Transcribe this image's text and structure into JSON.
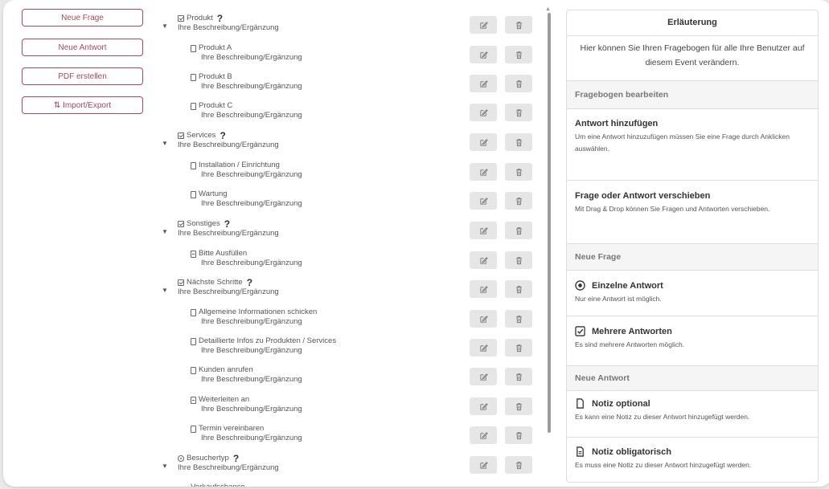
{
  "left_buttons": {
    "new_question": "Neue Frage",
    "new_answer": "Neue Antwort",
    "create_pdf": "PDF erstellen",
    "import_export": "Import/Export"
  },
  "tree": [
    {
      "kind": "question",
      "icon": "checkbox-icon",
      "title": "Produkt",
      "desc": "Ihre Beschreibung/Ergänzung"
    },
    {
      "kind": "answer",
      "icon": "document-icon",
      "title": "Produkt A",
      "desc": "Ihre Beschreibung/Ergänzung"
    },
    {
      "kind": "answer",
      "icon": "document-icon",
      "title": "Produkt B",
      "desc": "Ihre Beschreibung/Ergänzung"
    },
    {
      "kind": "answer",
      "icon": "document-icon",
      "title": "Produkt C",
      "desc": "Ihre Beschreibung/Ergänzung"
    },
    {
      "kind": "question",
      "icon": "checkbox-icon",
      "title": "Services",
      "desc": "Ihre Beschreibung/Ergänzung"
    },
    {
      "kind": "answer",
      "icon": "document-icon",
      "title": "Installation / Einrichtung",
      "desc": "Ihre Beschreibung/Ergänzung"
    },
    {
      "kind": "answer",
      "icon": "document-icon",
      "title": "Wartung",
      "desc": "Ihre Beschreibung/Ergänzung"
    },
    {
      "kind": "question",
      "icon": "checkbox-icon",
      "title": "Sonstiges",
      "desc": "Ihre Beschreibung/Ergänzung"
    },
    {
      "kind": "answer",
      "icon": "document-lines-icon",
      "title": "Bitte Ausfüllen",
      "desc": "Ihre Beschreibung/Ergänzung"
    },
    {
      "kind": "question",
      "icon": "checkbox-icon",
      "title": "Nächste Schritte",
      "desc": "Ihre Beschreibung/Ergänzung"
    },
    {
      "kind": "answer",
      "icon": "document-icon",
      "title": "Allgemeine Informationen schicken",
      "desc": "Ihre Beschreibung/Ergänzung"
    },
    {
      "kind": "answer",
      "icon": "document-icon",
      "title": "Detaillierte Infos zu Produkten / Services",
      "desc": "Ihre Beschreibung/Ergänzung"
    },
    {
      "kind": "answer",
      "icon": "document-icon",
      "title": "Kunden anrufen",
      "desc": "Ihre Beschreibung/Ergänzung"
    },
    {
      "kind": "answer",
      "icon": "document-lines-icon",
      "title": "Weiterleiten an",
      "desc": "Ihre Beschreibung/Ergänzung"
    },
    {
      "kind": "answer",
      "icon": "document-icon",
      "title": "Termin vereinbaren",
      "desc": "Ihre Beschreibung/Ergänzung"
    },
    {
      "kind": "question",
      "icon": "radio-icon",
      "title": "Besuchertyp",
      "desc": "Ihre Beschreibung/Ergänzung"
    },
    {
      "kind": "answer",
      "icon": "",
      "title": "Verkaufschance",
      "desc": ""
    }
  ],
  "question_mark": "?",
  "panel": {
    "title": "Erläuterung",
    "intro": "Hier können Sie Ihren Fragebogen für alle Ihre Benutzer auf diesem Event verändern.",
    "section_edit": "Fragebogen bearbeiten",
    "add_answer_title": "Antwort hinzufügen",
    "add_answer_desc": "Um eine Antwort hinzuzufügen müssen Sie eine Frage durch Anklicken auswählen.",
    "move_title": "Frage oder Antwort verschieben",
    "move_desc": "Mit Drag & Drop können Sie Fragen und Antworten verschieben.",
    "section_new_question": "Neue Frage",
    "single_title": "Einzelne Antwort",
    "single_desc": "Nur eine Antwort ist möglich.",
    "multi_title": "Mehrere Antworten",
    "multi_desc": "Es sind mehrere Antworten möglich.",
    "section_new_answer": "Neue Antwort",
    "note_opt_title": "Notiz optional",
    "note_opt_desc": "Es kann eine Notiz zu dieser Antwort hinzugefügt werden.",
    "note_req_title": "Notiz obligatorisch",
    "note_req_desc": "Es muss eine Notiz zu dieser Antwort hinzugefügt werden."
  },
  "colors": {
    "accent": "#a34a5a",
    "button_bg": "#e6e6e6"
  }
}
